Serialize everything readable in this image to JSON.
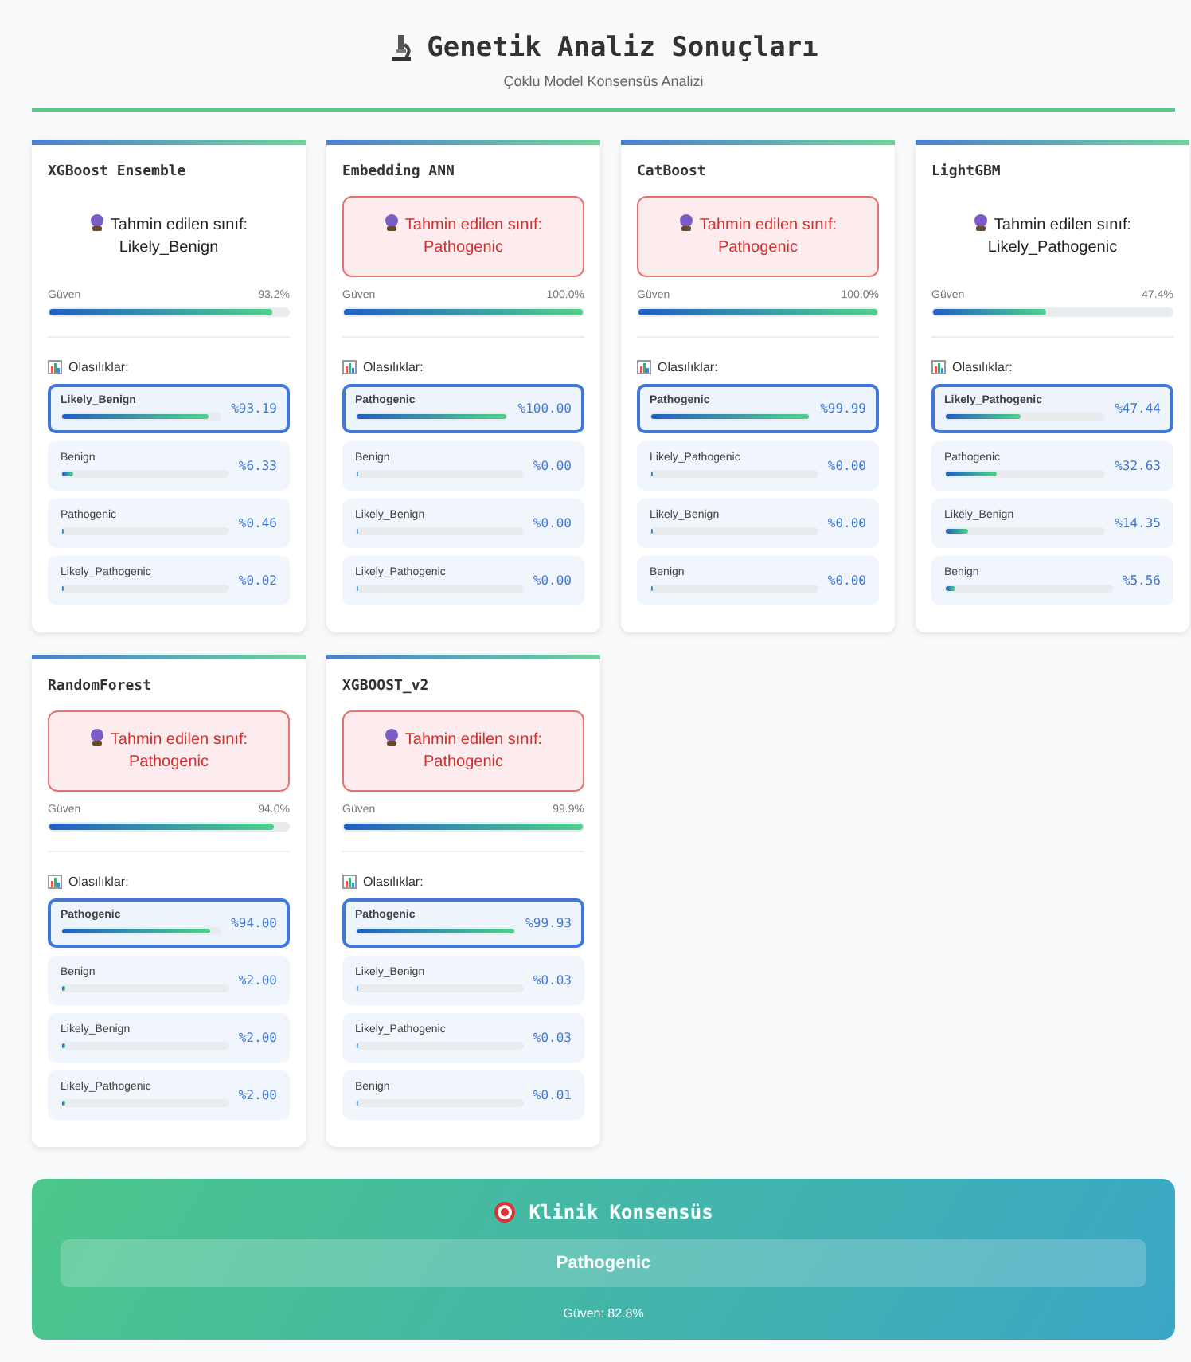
{
  "header": {
    "title": "Genetik Analiz Sonuçları",
    "subtitle": "Çoklu Model Konsensüs Analizi"
  },
  "models": [
    {
      "name": "XGBoost Ensemble",
      "prediction_label": "Tahmin edilen sınıf:",
      "prediction": "Likely_Benign",
      "alert": false,
      "confidence_label": "Güven",
      "confidence": "93.2%",
      "level": 0.932,
      "probs_label": "Olasılıklar:",
      "probs": [
        {
          "label": "Likely_Benign",
          "value": "%93.19",
          "level": 0.9319,
          "selected": true
        },
        {
          "label": "Benign",
          "value": "%6.33",
          "level": 0.0633,
          "selected": false
        },
        {
          "label": "Pathogenic",
          "value": "%0.46",
          "level": 0.0046,
          "selected": false
        },
        {
          "label": "Likely_Pathogenic",
          "value": "%0.02",
          "level": 0.0002,
          "selected": false
        }
      ]
    },
    {
      "name": "Embedding ANN",
      "prediction_label": "Tahmin edilen sınıf:",
      "prediction": "Pathogenic",
      "alert": true,
      "confidence_label": "Güven",
      "confidence": "100.0%",
      "level": 1,
      "probs_label": "Olasılıklar:",
      "probs": [
        {
          "label": "Pathogenic",
          "value": "%100.00",
          "level": 1,
          "selected": true
        },
        {
          "label": "Benign",
          "value": "%0.00",
          "level": 0,
          "selected": false
        },
        {
          "label": "Likely_Benign",
          "value": "%0.00",
          "level": 0,
          "selected": false
        },
        {
          "label": "Likely_Pathogenic",
          "value": "%0.00",
          "level": 0,
          "selected": false
        }
      ]
    },
    {
      "name": "CatBoost",
      "prediction_label": "Tahmin edilen sınıf:",
      "prediction": "Pathogenic",
      "alert": true,
      "confidence_label": "Güven",
      "confidence": "100.0%",
      "level": 1,
      "probs_label": "Olasılıklar:",
      "probs": [
        {
          "label": "Pathogenic",
          "value": "%99.99",
          "level": 0.9999,
          "selected": true
        },
        {
          "label": "Likely_Pathogenic",
          "value": "%0.00",
          "level": 0,
          "selected": false
        },
        {
          "label": "Likely_Benign",
          "value": "%0.00",
          "level": 0,
          "selected": false
        },
        {
          "label": "Benign",
          "value": "%0.00",
          "level": 0,
          "selected": false
        }
      ]
    },
    {
      "name": "LightGBM",
      "prediction_label": "Tahmin edilen sınıf:",
      "prediction": "Likely_Pathogenic",
      "alert": false,
      "confidence_label": "Güven",
      "confidence": "47.4%",
      "level": 0.474,
      "probs_label": "Olasılıklar:",
      "probs": [
        {
          "label": "Likely_Pathogenic",
          "value": "%47.44",
          "level": 0.4744,
          "selected": true
        },
        {
          "label": "Pathogenic",
          "value": "%32.63",
          "level": 0.3263,
          "selected": false
        },
        {
          "label": "Likely_Benign",
          "value": "%14.35",
          "level": 0.1435,
          "selected": false
        },
        {
          "label": "Benign",
          "value": "%5.56",
          "level": 0.0556,
          "selected": false
        }
      ]
    },
    {
      "name": "RandomForest",
      "prediction_label": "Tahmin edilen sınıf:",
      "prediction": "Pathogenic",
      "alert": true,
      "confidence_label": "Güven",
      "confidence": "94.0%",
      "level": 0.94,
      "probs_label": "Olasılıklar:",
      "probs": [
        {
          "label": "Pathogenic",
          "value": "%94.00",
          "level": 0.94,
          "selected": true
        },
        {
          "label": "Benign",
          "value": "%2.00",
          "level": 0.02,
          "selected": false
        },
        {
          "label": "Likely_Benign",
          "value": "%2.00",
          "level": 0.02,
          "selected": false
        },
        {
          "label": "Likely_Pathogenic",
          "value": "%2.00",
          "level": 0.02,
          "selected": false
        }
      ]
    },
    {
      "name": "XGBOOST_v2",
      "prediction_label": "Tahmin edilen sınıf:",
      "prediction": "Pathogenic",
      "alert": true,
      "confidence_label": "Güven",
      "confidence": "99.9%",
      "level": 0.999,
      "probs_label": "Olasılıklar:",
      "probs": [
        {
          "label": "Pathogenic",
          "value": "%99.93",
          "level": 0.9993,
          "selected": true
        },
        {
          "label": "Likely_Benign",
          "value": "%0.03",
          "level": 0.0003,
          "selected": false
        },
        {
          "label": "Likely_Pathogenic",
          "value": "%0.03",
          "level": 0.0003,
          "selected": false
        },
        {
          "label": "Benign",
          "value": "%0.01",
          "level": 0.0001,
          "selected": false
        }
      ]
    }
  ],
  "consensus": {
    "title": "Klinik Konsensüs",
    "result": "Pathogenic",
    "confidence": "Güven: 82.8%"
  }
}
